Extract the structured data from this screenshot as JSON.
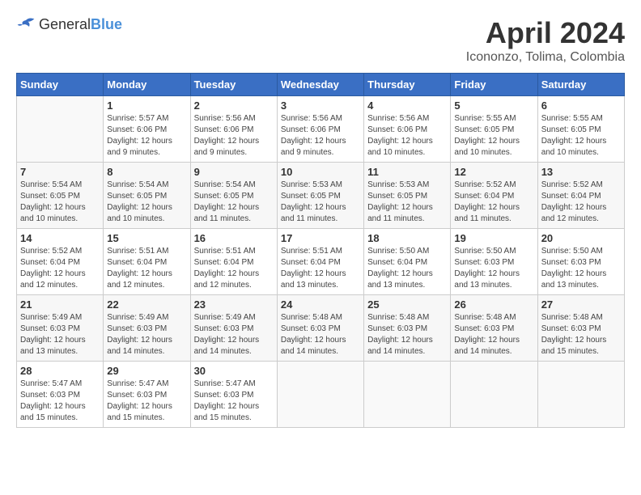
{
  "header": {
    "logo_general": "General",
    "logo_blue": "Blue",
    "title": "April 2024",
    "subtitle": "Icononzo, Tolima, Colombia"
  },
  "calendar": {
    "days_of_week": [
      "Sunday",
      "Monday",
      "Tuesday",
      "Wednesday",
      "Thursday",
      "Friday",
      "Saturday"
    ],
    "weeks": [
      [
        {
          "day": "",
          "info": ""
        },
        {
          "day": "1",
          "info": "Sunrise: 5:57 AM\nSunset: 6:06 PM\nDaylight: 12 hours\nand 9 minutes."
        },
        {
          "day": "2",
          "info": "Sunrise: 5:56 AM\nSunset: 6:06 PM\nDaylight: 12 hours\nand 9 minutes."
        },
        {
          "day": "3",
          "info": "Sunrise: 5:56 AM\nSunset: 6:06 PM\nDaylight: 12 hours\nand 9 minutes."
        },
        {
          "day": "4",
          "info": "Sunrise: 5:56 AM\nSunset: 6:06 PM\nDaylight: 12 hours\nand 10 minutes."
        },
        {
          "day": "5",
          "info": "Sunrise: 5:55 AM\nSunset: 6:05 PM\nDaylight: 12 hours\nand 10 minutes."
        },
        {
          "day": "6",
          "info": "Sunrise: 5:55 AM\nSunset: 6:05 PM\nDaylight: 12 hours\nand 10 minutes."
        }
      ],
      [
        {
          "day": "7",
          "info": "Sunrise: 5:54 AM\nSunset: 6:05 PM\nDaylight: 12 hours\nand 10 minutes."
        },
        {
          "day": "8",
          "info": "Sunrise: 5:54 AM\nSunset: 6:05 PM\nDaylight: 12 hours\nand 10 minutes."
        },
        {
          "day": "9",
          "info": "Sunrise: 5:54 AM\nSunset: 6:05 PM\nDaylight: 12 hours\nand 11 minutes."
        },
        {
          "day": "10",
          "info": "Sunrise: 5:53 AM\nSunset: 6:05 PM\nDaylight: 12 hours\nand 11 minutes."
        },
        {
          "day": "11",
          "info": "Sunrise: 5:53 AM\nSunset: 6:05 PM\nDaylight: 12 hours\nand 11 minutes."
        },
        {
          "day": "12",
          "info": "Sunrise: 5:52 AM\nSunset: 6:04 PM\nDaylight: 12 hours\nand 11 minutes."
        },
        {
          "day": "13",
          "info": "Sunrise: 5:52 AM\nSunset: 6:04 PM\nDaylight: 12 hours\nand 12 minutes."
        }
      ],
      [
        {
          "day": "14",
          "info": "Sunrise: 5:52 AM\nSunset: 6:04 PM\nDaylight: 12 hours\nand 12 minutes."
        },
        {
          "day": "15",
          "info": "Sunrise: 5:51 AM\nSunset: 6:04 PM\nDaylight: 12 hours\nand 12 minutes."
        },
        {
          "day": "16",
          "info": "Sunrise: 5:51 AM\nSunset: 6:04 PM\nDaylight: 12 hours\nand 12 minutes."
        },
        {
          "day": "17",
          "info": "Sunrise: 5:51 AM\nSunset: 6:04 PM\nDaylight: 12 hours\nand 13 minutes."
        },
        {
          "day": "18",
          "info": "Sunrise: 5:50 AM\nSunset: 6:04 PM\nDaylight: 12 hours\nand 13 minutes."
        },
        {
          "day": "19",
          "info": "Sunrise: 5:50 AM\nSunset: 6:03 PM\nDaylight: 12 hours\nand 13 minutes."
        },
        {
          "day": "20",
          "info": "Sunrise: 5:50 AM\nSunset: 6:03 PM\nDaylight: 12 hours\nand 13 minutes."
        }
      ],
      [
        {
          "day": "21",
          "info": "Sunrise: 5:49 AM\nSunset: 6:03 PM\nDaylight: 12 hours\nand 13 minutes."
        },
        {
          "day": "22",
          "info": "Sunrise: 5:49 AM\nSunset: 6:03 PM\nDaylight: 12 hours\nand 14 minutes."
        },
        {
          "day": "23",
          "info": "Sunrise: 5:49 AM\nSunset: 6:03 PM\nDaylight: 12 hours\nand 14 minutes."
        },
        {
          "day": "24",
          "info": "Sunrise: 5:48 AM\nSunset: 6:03 PM\nDaylight: 12 hours\nand 14 minutes."
        },
        {
          "day": "25",
          "info": "Sunrise: 5:48 AM\nSunset: 6:03 PM\nDaylight: 12 hours\nand 14 minutes."
        },
        {
          "day": "26",
          "info": "Sunrise: 5:48 AM\nSunset: 6:03 PM\nDaylight: 12 hours\nand 14 minutes."
        },
        {
          "day": "27",
          "info": "Sunrise: 5:48 AM\nSunset: 6:03 PM\nDaylight: 12 hours\nand 15 minutes."
        }
      ],
      [
        {
          "day": "28",
          "info": "Sunrise: 5:47 AM\nSunset: 6:03 PM\nDaylight: 12 hours\nand 15 minutes."
        },
        {
          "day": "29",
          "info": "Sunrise: 5:47 AM\nSunset: 6:03 PM\nDaylight: 12 hours\nand 15 minutes."
        },
        {
          "day": "30",
          "info": "Sunrise: 5:47 AM\nSunset: 6:03 PM\nDaylight: 12 hours\nand 15 minutes."
        },
        {
          "day": "",
          "info": ""
        },
        {
          "day": "",
          "info": ""
        },
        {
          "day": "",
          "info": ""
        },
        {
          "day": "",
          "info": ""
        }
      ]
    ]
  }
}
